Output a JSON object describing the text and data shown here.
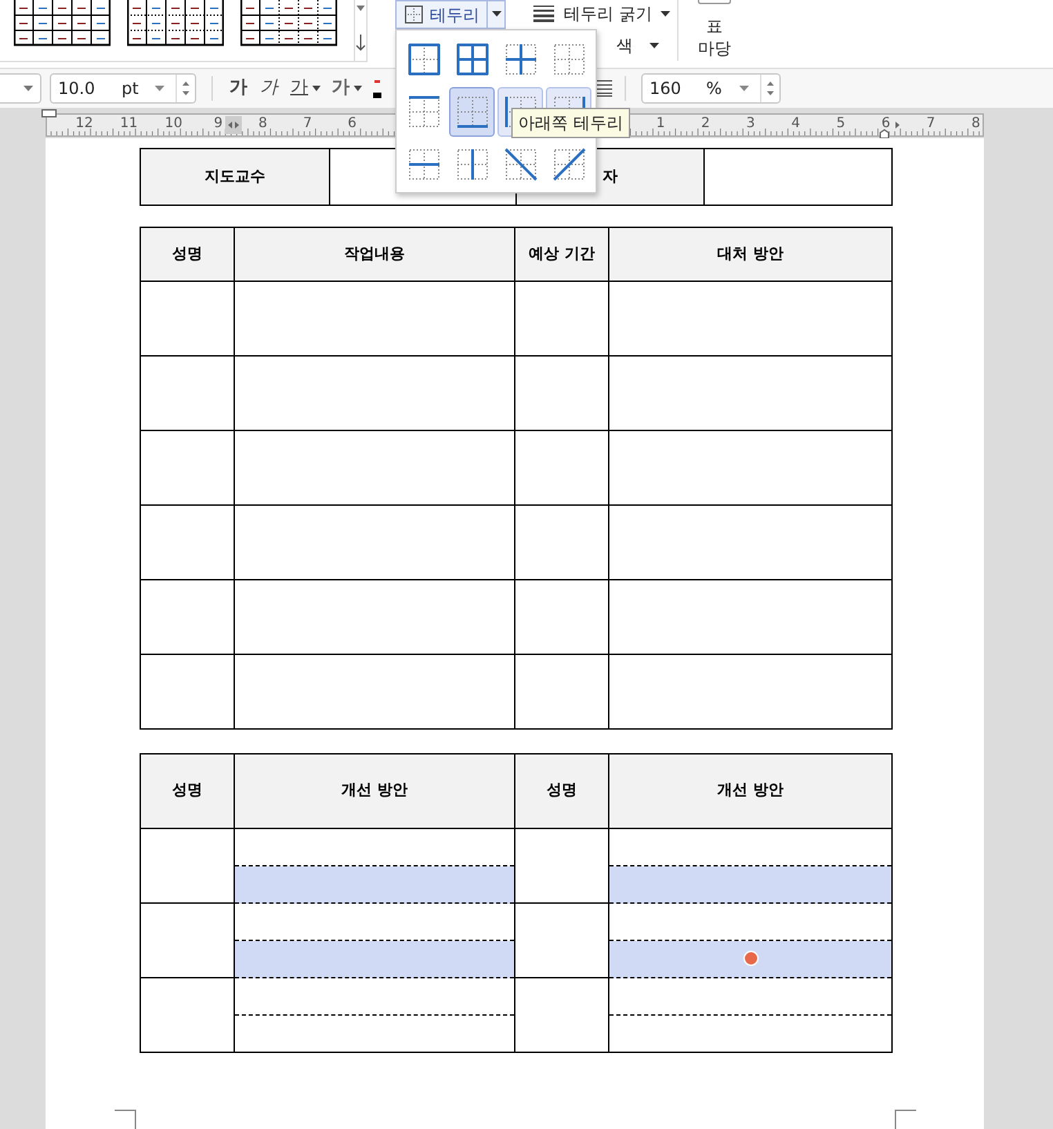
{
  "ribbon": {
    "border_button": {
      "label": "테두리"
    },
    "border_thickness": {
      "label": "테두리 굵기"
    },
    "border_color": {
      "label": "색"
    },
    "table_gallery": {
      "label_lines": [
        "표",
        "마당"
      ]
    }
  },
  "format_bar": {
    "font_size": {
      "value": "10.0",
      "unit": "pt"
    },
    "text_styles": [
      {
        "label": "가",
        "kind": "bold",
        "dropdown": false
      },
      {
        "label": "가",
        "kind": "italic",
        "dropdown": false
      },
      {
        "label": "가",
        "kind": "underline",
        "dropdown": true
      },
      {
        "label": "가",
        "kind": "outline",
        "dropdown": true
      }
    ],
    "zoom": {
      "value": "160",
      "unit": "%"
    }
  },
  "ruler": {
    "left_labels": [
      "12",
      "11",
      "10",
      "9",
      "8",
      "7",
      "6"
    ],
    "right_labels": [
      "1",
      "2",
      "3",
      "4",
      "5",
      "6",
      "7",
      "8"
    ]
  },
  "border_menu": {
    "items": [
      {
        "kind": "outer",
        "selected": false,
        "highlighted": false
      },
      {
        "kind": "all",
        "selected": false,
        "highlighted": false
      },
      {
        "kind": "inner",
        "selected": false,
        "highlighted": false
      },
      {
        "kind": "none",
        "selected": false,
        "highlighted": false
      },
      {
        "kind": "top",
        "selected": false,
        "highlighted": false
      },
      {
        "kind": "bottom",
        "selected": true,
        "highlighted": true
      },
      {
        "kind": "left",
        "selected": false,
        "highlighted": true
      },
      {
        "kind": "right",
        "selected": false,
        "highlighted": true
      },
      {
        "kind": "inner-horizontal",
        "selected": false,
        "highlighted": false
      },
      {
        "kind": "inner-vertical",
        "selected": false,
        "highlighted": false
      },
      {
        "kind": "diagonal-down",
        "selected": false,
        "highlighted": false
      },
      {
        "kind": "diagonal-up",
        "selected": false,
        "highlighted": false
      }
    ]
  },
  "tooltip": {
    "text": "아래쪽 테두리"
  },
  "info_table": {
    "cells": [
      {
        "text": "지도교수",
        "header": true
      },
      {
        "header": false
      },
      {
        "text": "자",
        "header": true
      },
      {
        "header": false
      }
    ]
  },
  "task_table": {
    "columns": [
      "성명",
      "작업내용",
      "예상 기간",
      "대처 방안"
    ],
    "rows": [
      {
        "selected": false
      },
      {
        "selected": false
      },
      {
        "selected": false
      },
      {
        "selected": false
      },
      {
        "selected": false
      },
      {
        "selected": false
      }
    ]
  },
  "plan_table": {
    "columns": [
      "성명",
      "개선 방안",
      "성명",
      "개선 방안"
    ],
    "rows": [
      {
        "left_lines": [
          {
            "selected": false,
            "marker": false
          },
          {
            "selected": true,
            "marker": false
          }
        ],
        "right_lines": [
          {
            "selected": false,
            "marker": false
          },
          {
            "selected": true,
            "marker": false
          }
        ]
      },
      {
        "left_lines": [
          {
            "selected": false,
            "marker": false
          },
          {
            "selected": true,
            "marker": false
          }
        ],
        "right_lines": [
          {
            "selected": false,
            "marker": false
          },
          {
            "selected": true,
            "marker": true
          }
        ]
      },
      {
        "left_lines": [
          {
            "selected": false,
            "marker": false
          },
          {
            "selected": false,
            "marker": false
          }
        ],
        "right_lines": [
          {
            "selected": false,
            "marker": false
          },
          {
            "selected": false,
            "marker": false
          }
        ]
      }
    ]
  }
}
